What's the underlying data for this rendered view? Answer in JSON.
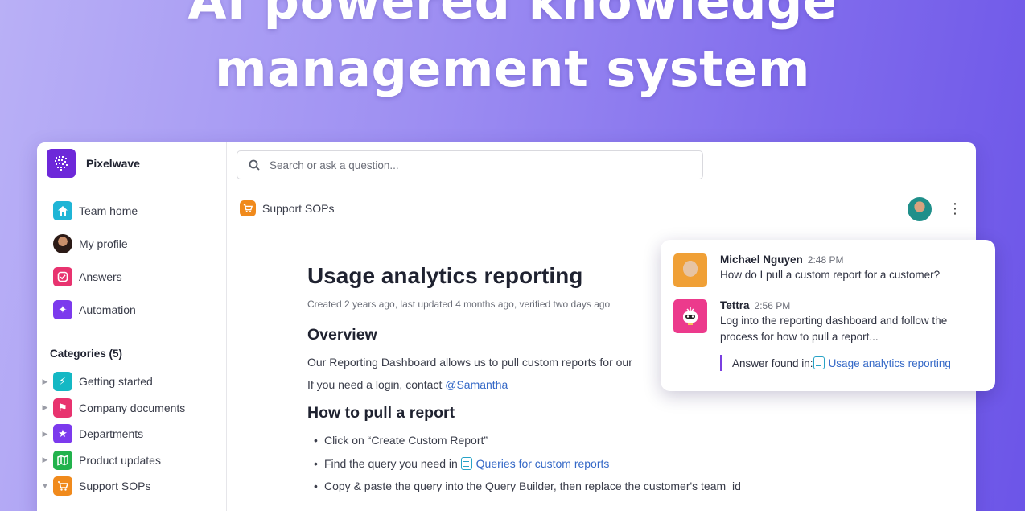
{
  "hero": {
    "line1": "AI powered knowledge",
    "line2": "management system"
  },
  "workspace": {
    "name": "Pixelwave",
    "logo_icon": "pixel-globe-icon"
  },
  "nav": [
    {
      "label": "Team home",
      "icon": "home-icon",
      "color": "#1fb5d6"
    },
    {
      "label": "My profile",
      "icon": "avatar"
    },
    {
      "label": "Answers",
      "icon": "check-badge-icon",
      "color": "#e8336f"
    },
    {
      "label": "Automation",
      "icon": "sparkle-icon",
      "color": "#7c3aed"
    }
  ],
  "categories": {
    "title": "Categories (5)",
    "items": [
      {
        "label": "Getting started",
        "icon": "bolt-icon",
        "color": "#14b8c4",
        "expanded": false
      },
      {
        "label": "Company documents",
        "icon": "flag-icon",
        "color": "#e8336f",
        "expanded": false
      },
      {
        "label": "Departments",
        "icon": "star-icon",
        "color": "#7c3aed",
        "expanded": false
      },
      {
        "label": "Product updates",
        "icon": "map-icon",
        "color": "#22b24c",
        "expanded": false
      },
      {
        "label": "Support SOPs",
        "icon": "cart-icon",
        "color": "#f08a1c",
        "expanded": true
      }
    ]
  },
  "search": {
    "placeholder": "Search or ask a question..."
  },
  "breadcrumb": {
    "label": "Support SOPs",
    "icon": "cart-icon"
  },
  "document": {
    "title": "Usage analytics reporting",
    "meta": "Created 2 years ago, last updated 4 months ago, verified two days ago",
    "overview_heading": "Overview",
    "overview_text": "Our Reporting Dashboard allows us to pull custom reports for our",
    "login_text": "If you need a login, contact ",
    "login_mention": "@Samantha",
    "steps_heading": "How to pull a report",
    "steps": {
      "s1": "Click on “Create Custom Report”",
      "s2_prefix": "Find the query you need in ",
      "s2_link": "Queries for custom reports",
      "s3": "Copy & paste the query into the Query Builder, then replace the customer's team_id"
    }
  },
  "chat": {
    "messages": [
      {
        "author": "Michael Nguyen",
        "time": "2:48 PM",
        "text": "How do I pull a custom report for a customer?"
      },
      {
        "author": "Tettra",
        "time": "2:56 PM",
        "text": "Log into the reporting dashboard and follow the process for how to pull a report..."
      }
    ],
    "answer_label": "Answer found in: ",
    "answer_link": "Usage analytics reporting",
    "accent": "#7a3fe0"
  }
}
